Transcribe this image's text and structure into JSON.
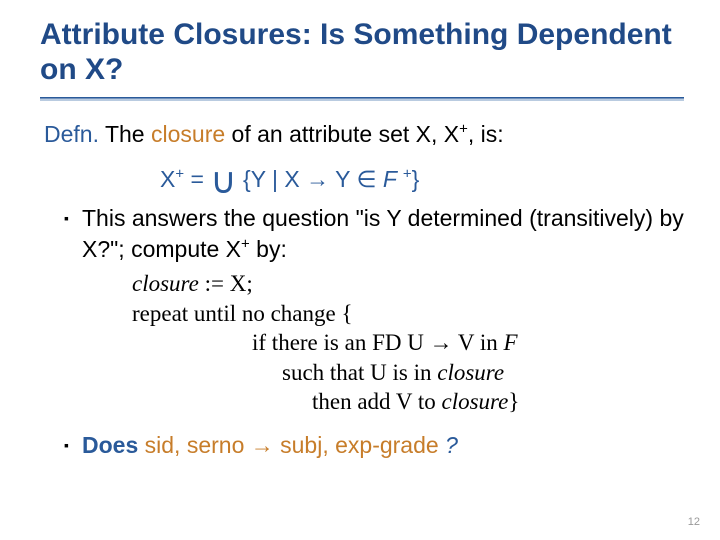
{
  "title": "Attribute Closures:  Is Something Dependent on X?",
  "defn_label": "Defn.",
  "defn_text_1": "The ",
  "defn_text_closure": "closure",
  "defn_text_2": " of an attribute set X, X",
  "defn_text_3": ", is:",
  "formula": {
    "lhs": "X",
    "eq": " = ",
    "set_open": " {Y | X ",
    "arrow1": "→",
    "mid": " Y ",
    "elem": "∈",
    "F": " F ",
    "set_close": "}"
  },
  "bullet1_a": "This answers the question \"is Y determined (transitively) by X?\"; compute X",
  "bullet1_b": "  by:",
  "algo": {
    "l1_a": "closure",
    "l1_b": " := X;",
    "l2": "repeat until no change {",
    "l3_a": "if there is an FD U ",
    "l3_b": " V in ",
    "l3_c": "F",
    "l4_a": "such that U is in ",
    "l4_b": "closure",
    "l5_a": "then add V to ",
    "l5_b": "closure",
    "l5_c": "}"
  },
  "bullet2_label": "Does ",
  "bullet2_text_a": " sid, serno ",
  "bullet2_text_b": " subj, exp-grade",
  "bullet2_q": "?",
  "page_number": "12"
}
